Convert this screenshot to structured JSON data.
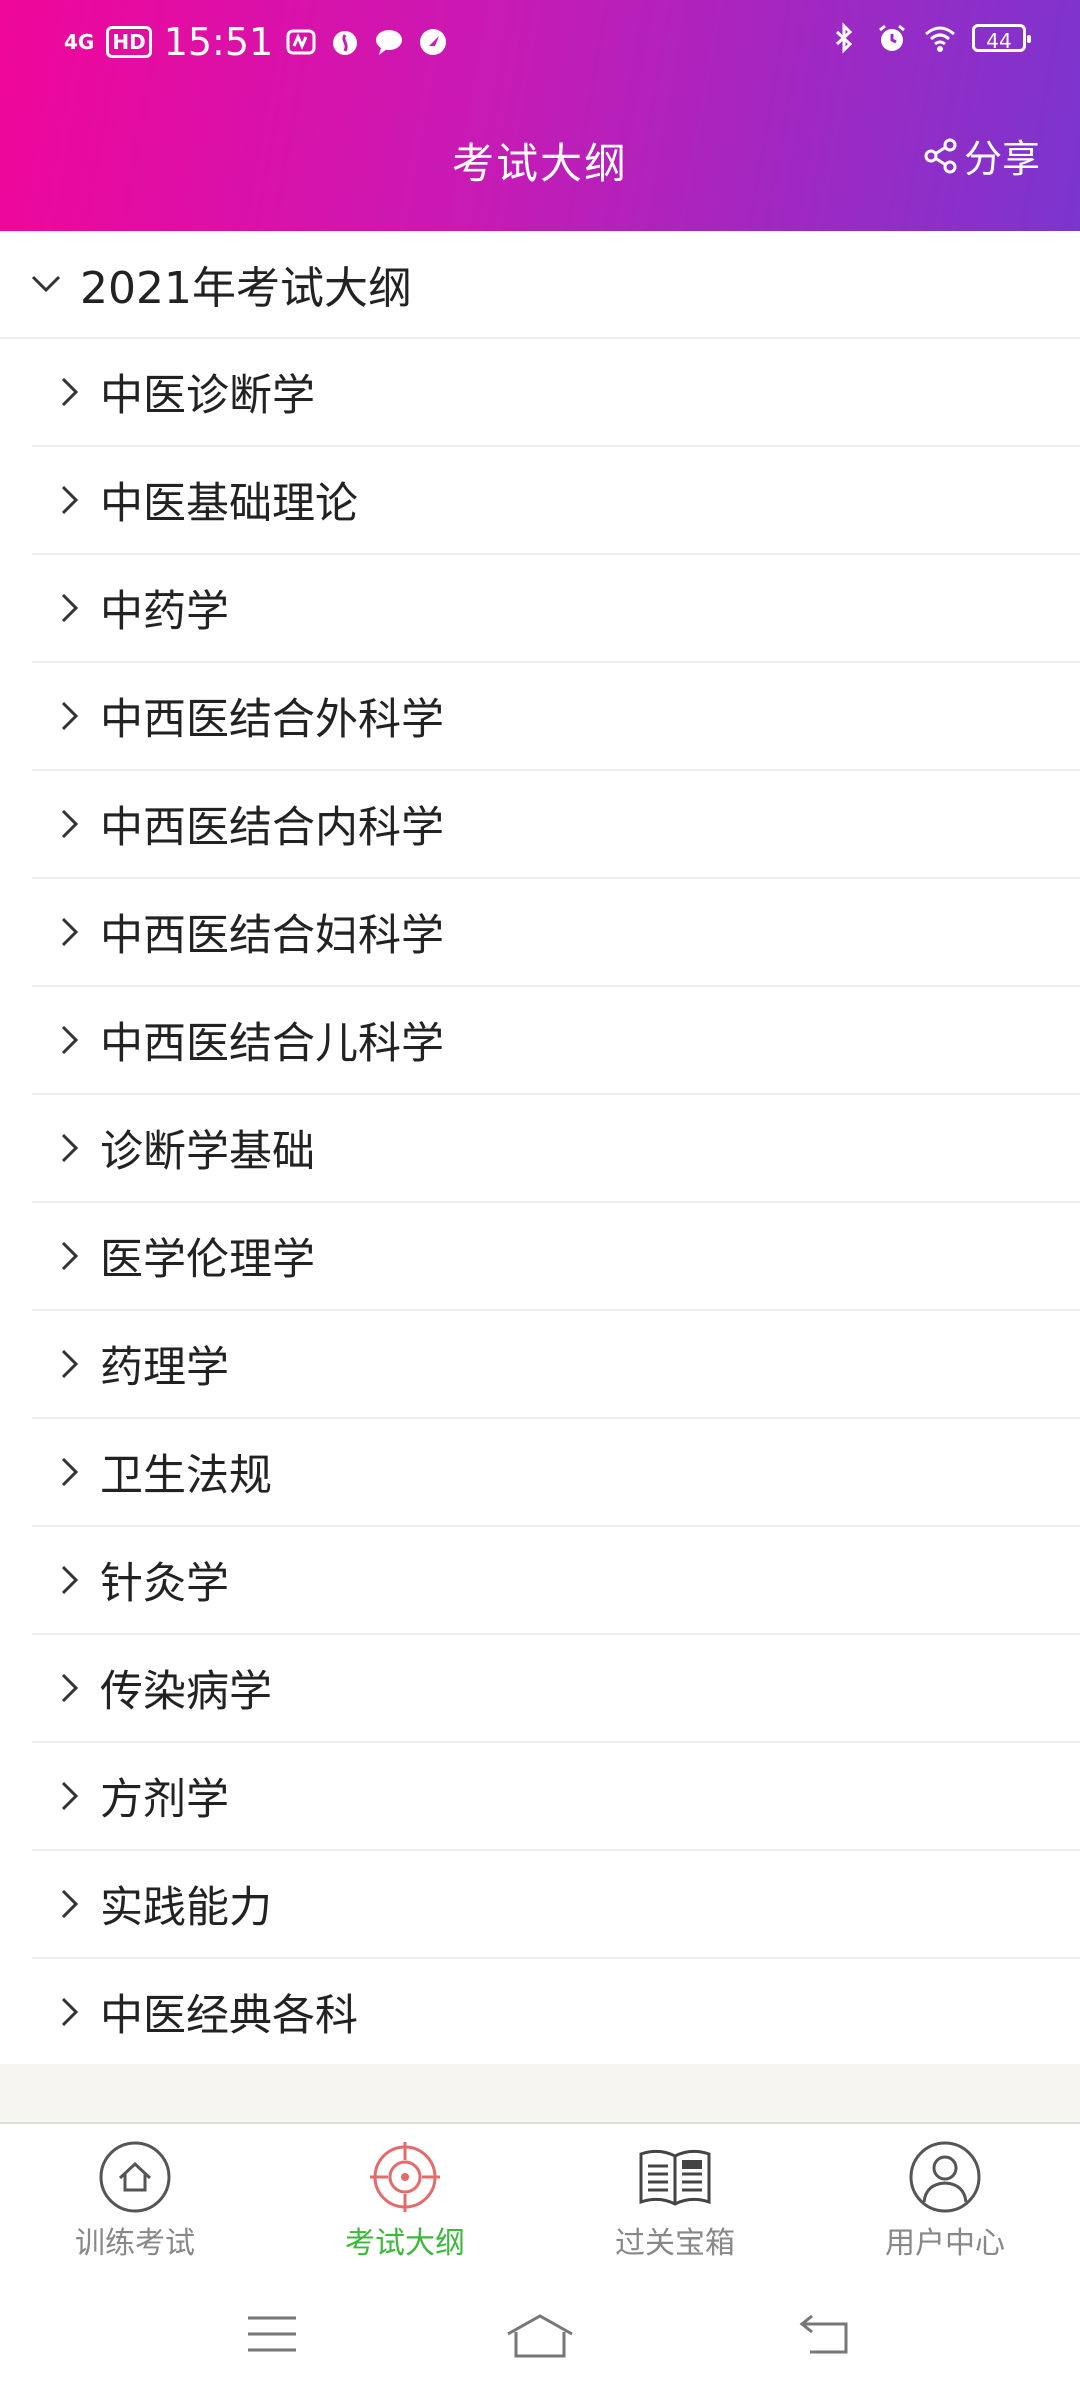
{
  "status_bar": {
    "network": "4G",
    "hd": "HD",
    "time": "15:51",
    "battery": "44"
  },
  "header": {
    "title": "考试大纲",
    "share_label": "分享"
  },
  "outline": {
    "group_title": "2021年考试大纲",
    "items": [
      "中医诊断学",
      "中医基础理论",
      "中药学",
      "中西医结合外科学",
      "中西医结合内科学",
      "中西医结合妇科学",
      "中西医结合儿科学",
      "诊断学基础",
      "医学伦理学",
      "药理学",
      "卫生法规",
      "针灸学",
      "传染病学",
      "方剂学",
      "实践能力",
      "中医经典各科"
    ]
  },
  "tabbar": {
    "tabs": [
      {
        "label": "训练考试",
        "icon": "home-icon"
      },
      {
        "label": "考试大纲",
        "icon": "target-icon"
      },
      {
        "label": "过关宝箱",
        "icon": "news-book-icon"
      },
      {
        "label": "用户中心",
        "icon": "user-icon"
      }
    ],
    "active_color": "#3ab93a",
    "active_icon_color": "#e66a6a"
  },
  "colors": {
    "header_gradient": [
      "#f0069a",
      "#c81ab4",
      "#7b35cf"
    ]
  }
}
